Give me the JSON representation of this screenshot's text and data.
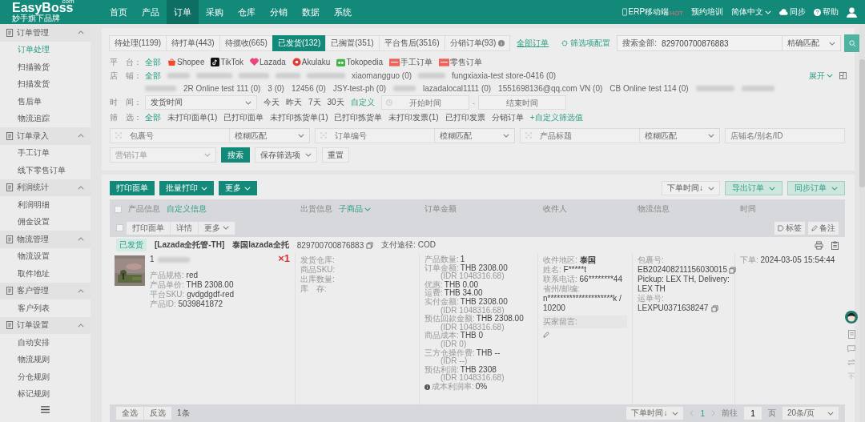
{
  "brand": {
    "name": "EasyBoss",
    "suffix": "com",
    "tagline": "妙手旗下品牌"
  },
  "nav": [
    {
      "label": "首页",
      "selected": false
    },
    {
      "label": "产品",
      "selected": false
    },
    {
      "label": "订单",
      "selected": true
    },
    {
      "label": "采购",
      "selected": false
    },
    {
      "label": "仓库",
      "selected": false
    },
    {
      "label": "分销",
      "selected": false
    },
    {
      "label": "数据",
      "selected": false
    },
    {
      "label": "系统",
      "selected": false
    }
  ],
  "header_links": [
    {
      "kind": "mobile",
      "label": "ERP移动端",
      "badge": "HOT"
    },
    {
      "kind": "plain",
      "label": "预约培训"
    },
    {
      "kind": "language",
      "label": "简体中文"
    },
    {
      "kind": "sync",
      "label": "同步"
    },
    {
      "kind": "help",
      "label": "帮助"
    }
  ],
  "sidebar": [
    {
      "label": "订单管理",
      "expanded": true,
      "children": [
        {
          "label": "订单处理",
          "selected": true
        },
        {
          "label": "扫描验货",
          "selected": false
        },
        {
          "label": "扫描发货",
          "selected": false
        },
        {
          "label": "售后单",
          "selected": false
        },
        {
          "label": "物流追踪",
          "selected": false
        }
      ]
    },
    {
      "label": "订单录入",
      "expanded": true,
      "children": [
        {
          "label": "手工订单",
          "selected": false
        },
        {
          "label": "线下零售订单",
          "selected": false
        }
      ]
    },
    {
      "label": "利润统计",
      "expanded": true,
      "children": [
        {
          "label": "利润明细",
          "selected": false
        },
        {
          "label": "佣金设置",
          "selected": false
        }
      ]
    },
    {
      "label": "物流管理",
      "expanded": true,
      "children": [
        {
          "label": "物流设置",
          "selected": false
        },
        {
          "label": "取件地址",
          "selected": false
        }
      ]
    },
    {
      "label": "客户管理",
      "expanded": true,
      "children": [
        {
          "label": "客户列表",
          "selected": false
        }
      ]
    },
    {
      "label": "订单设置",
      "expanded": true,
      "children": [
        {
          "label": "自动安排",
          "selected": false
        },
        {
          "label": "物流规则",
          "selected": false
        },
        {
          "label": "分仓规则",
          "selected": false
        },
        {
          "label": "标记规则",
          "selected": false
        }
      ]
    }
  ],
  "status_tabs": [
    {
      "label": "待处理(1199)",
      "selected": false
    },
    {
      "label": "待打单(443)",
      "selected": false
    },
    {
      "label": "待揽收(665)",
      "selected": false
    },
    {
      "label": "已发货(132)",
      "selected": true
    },
    {
      "label": "已搁置(351)",
      "selected": false
    },
    {
      "label": "平台售后(3516)",
      "selected": false
    },
    {
      "label": "分销订单(93)",
      "selected": false,
      "info": true
    }
  ],
  "all_orders_link": "全部订单",
  "filter_config": "筛选项配置",
  "search": {
    "label": "搜索全部:",
    "value": "829700700876883",
    "match": "精确匹配"
  },
  "platform_filter": {
    "label": "平　台：",
    "options": [
      {
        "kind": "all",
        "label": "全部",
        "selected": true
      },
      {
        "kind": "shopee",
        "label": "Shopee",
        "selected": false
      },
      {
        "kind": "tiktok",
        "label": "TikTok",
        "selected": false
      },
      {
        "kind": "lazada",
        "label": "Lazada",
        "selected": false
      },
      {
        "kind": "akulaku",
        "label": "Akulaku",
        "selected": false
      },
      {
        "kind": "tokopedia",
        "label": "Tokopedia",
        "selected": false
      },
      {
        "kind": "manual",
        "label": "手工订单",
        "selected": false
      },
      {
        "kind": "retail",
        "label": "零售订单",
        "selected": false
      }
    ]
  },
  "store_filter": {
    "label": "店　铺：",
    "all": "全部",
    "expand": "展开",
    "rows": [
      [
        {
          "kind": "redacted"
        },
        {
          "kind": "redacted"
        },
        {
          "kind": "redacted"
        },
        {
          "kind": "redacted"
        },
        {
          "kind": "redacted"
        },
        {
          "kind": "name",
          "label": "xiaomangguo (0)"
        },
        {
          "kind": "redacted"
        },
        {
          "kind": "name",
          "label": "fungxiaxia-test store-0416 (0)"
        }
      ],
      [
        {
          "kind": "redacted"
        },
        {
          "kind": "name",
          "label": "2R Online test 111 (0)"
        },
        {
          "kind": "name",
          "label": "3 (0)"
        },
        {
          "kind": "name",
          "label": "12456 (0)"
        },
        {
          "kind": "name",
          "label": "JSY-test-ph (0)"
        },
        {
          "kind": "redacted"
        },
        {
          "kind": "name",
          "label": "lazadalocal1111 (0)"
        },
        {
          "kind": "name",
          "label": "1551698136@qq.com VN (0)"
        },
        {
          "kind": "name",
          "label": "CB Online test 114 (0)"
        },
        {
          "kind": "redacted"
        },
        {
          "kind": "redacted"
        }
      ]
    ]
  },
  "time_filter": {
    "label": "时　间：",
    "field": "发货时间",
    "options": [
      {
        "label": "今天",
        "selected": false
      },
      {
        "label": "昨天",
        "selected": false
      },
      {
        "label": "7天",
        "selected": false
      },
      {
        "label": "30天",
        "selected": false
      },
      {
        "label": "自定义",
        "selected": true
      }
    ],
    "start_placeholder": "开始时间",
    "separator": "-",
    "end_placeholder": "结束时间"
  },
  "quick_filter": {
    "label": "筛　选：",
    "options": [
      {
        "label": "全部",
        "selected": true
      },
      {
        "label": "未打印面单(1)",
        "selected": false
      },
      {
        "label": "已打印面单",
        "selected": false
      },
      {
        "label": "未打印拣货单(1)",
        "selected": false
      },
      {
        "label": "已打印拣货单",
        "selected": false
      },
      {
        "label": "未打印发票(1)",
        "selected": false
      },
      {
        "label": "已打印发票",
        "selected": false
      },
      {
        "label": "分销订单",
        "selected": false
      }
    ],
    "custom": "+自定义筛选值"
  },
  "search_fields": [
    {
      "placeholder": "包裹号",
      "match": "模糊匹配"
    },
    {
      "placeholder": "订单编号",
      "match": "模糊匹配"
    },
    {
      "placeholder": "产品标题",
      "match": "模糊匹配"
    }
  ],
  "store_field": {
    "placeholder": "店铺名/别名/ID"
  },
  "marketing_select": {
    "placeholder": "营销订单"
  },
  "search_button": "搜索",
  "save_filter": "保存筛选项",
  "reset_button": "重置",
  "actions": [
    {
      "label": "打印面单",
      "menu": false
    },
    {
      "label": "批量打印",
      "menu": true
    },
    {
      "label": "更多",
      "menu": true
    }
  ],
  "sort_select": "下单时间↓",
  "right_actions": [
    {
      "label": "导出订单"
    },
    {
      "label": "同步订单"
    }
  ],
  "table": {
    "select_all_checked": false,
    "columns": [
      {
        "label": "产品信息",
        "link": "自定义信息"
      },
      {
        "label": "出货信息",
        "link": "子商品"
      },
      {
        "label": "订单金额"
      },
      {
        "label": "收件人"
      },
      {
        "label": "物流信息"
      },
      {
        "label": "时间"
      }
    ]
  },
  "order": {
    "checked": false,
    "buttons": [
      {
        "label": "打印面单",
        "menu": false
      },
      {
        "label": "详情",
        "menu": false
      },
      {
        "label": "更多",
        "menu": true
      }
    ],
    "tools": [
      {
        "kind": "tag",
        "label": "标签"
      },
      {
        "kind": "note",
        "label": "备注"
      }
    ],
    "status": "已发货",
    "store": "[Lazada全托管-TH]",
    "shop": "泰国lazada全托",
    "number": "829700700876883",
    "payment_label": "支付途径:",
    "payment": "COD",
    "product": {
      "name": "1",
      "specs": [
        {
          "label": "产品规格:",
          "value": "red"
        },
        {
          "label": "产品单价:",
          "value": "THB 2308.00"
        },
        {
          "label": "平台SKU:",
          "value": "gvdgdgdf-red"
        },
        {
          "label": "产品ID:",
          "value": "5039841872"
        }
      ],
      "quantity": "×1"
    },
    "shipping": [
      "发货仓库:",
      "商品SKU:",
      "出库数量:",
      "库　存:"
    ],
    "amounts": [
      {
        "label": "产品数量:",
        "value": "1"
      },
      {
        "label": "订单金额:",
        "value": "THB 2308.00",
        "sub": "(IDR 1048316.68)"
      },
      {
        "label": "优惠:",
        "value": "THB 0.00"
      },
      {
        "label": "运费:",
        "value": "THB 34.00"
      },
      {
        "label": "实付金额:",
        "value": "THB 2308.00",
        "sub": "(IDR 1048316.68)"
      },
      {
        "label": "预估回款金额:",
        "value": "THB 2308.00",
        "sub": "(IDR 1048316.68)"
      },
      {
        "label": "商品成本:",
        "value": "THB 0",
        "sub": "(IDR 0)"
      },
      {
        "label": "三方仓操作费:",
        "value": "THB --",
        "sub": "(IDR --)"
      },
      {
        "label": "预估利润:",
        "value": "THB 2308",
        "sub": "(IDR 1048316.68)"
      },
      {
        "label": "成本利润率:",
        "value": "0%",
        "hint": true
      }
    ],
    "recipient": {
      "fields": [
        {
          "label": "收件地区:",
          "value": "泰国"
        },
        {
          "label": "姓名:",
          "value": "F*****t"
        },
        {
          "label": "联系电话:",
          "value": "66********44"
        }
      ],
      "postal_label": "省州/邮编:",
      "postal": "n*********************k / 10200",
      "message_label": "买家留言:"
    },
    "logistics": {
      "package_label": "包裹号:",
      "package": "EB202408211156030015",
      "route": "Pickup: LEX TH, Delivery: LEX TH",
      "tracking_label": "运单号:",
      "tracking": "LEXPU0371638247"
    },
    "time_label": "下单:",
    "time": "2024-03-05 15:54:44"
  },
  "footer": {
    "buttons": [
      "全选",
      "反选"
    ],
    "count": "1条",
    "sort": "下单时间↓",
    "page": "1",
    "goto": "前往",
    "goto_value": "1",
    "page_unit": "页",
    "page_size": "20条/页"
  }
}
